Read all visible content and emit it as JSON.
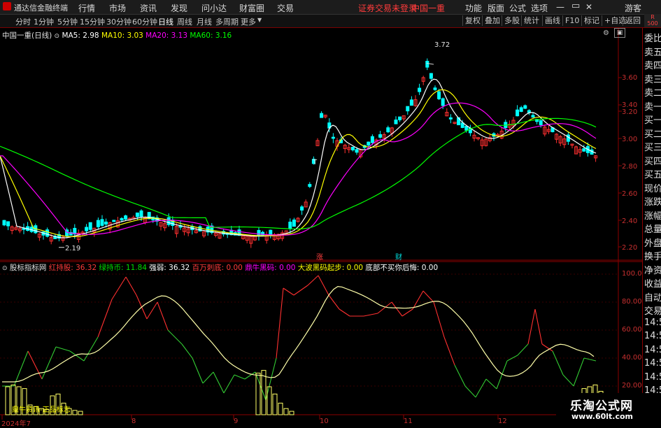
{
  "titlebar": {
    "app_name": "通达信金融终端",
    "menu": [
      "行情",
      "市场",
      "资讯",
      "发现",
      "问小达",
      "财富圈",
      "交易"
    ],
    "status": "证券交易未登录",
    "stock": "中国一重",
    "right_menu": [
      "功能",
      "版面",
      "公式",
      "选项"
    ],
    "guest": "游客"
  },
  "toolbar": {
    "periods": [
      "分时",
      "1分钟",
      "5分钟",
      "15分钟",
      "30分钟",
      "60分钟",
      "日线",
      "周线",
      "月线",
      "多周期",
      "更多"
    ],
    "active_period": "日线",
    "right_buttons": [
      "复权",
      "叠加",
      "多股",
      "统计",
      "画线",
      "F10",
      "标记",
      "+自选",
      "返回"
    ],
    "corner_badge_top": "R",
    "corner_badge_bottom": "500"
  },
  "main_chart": {
    "title": "中国一重(日线)",
    "ma": [
      {
        "label": "MA5: 2.98",
        "color": "#ffffff"
      },
      {
        "label": "MA10: 3.03",
        "color": "#ffff00"
      },
      {
        "label": "MA20: 3.13",
        "color": "#ff00ff"
      },
      {
        "label": "MA60: 3.16",
        "color": "#00ff00"
      }
    ],
    "y_ticks": [
      "3.60",
      "3.40",
      "3.20",
      "3.00",
      "2.80",
      "2.60",
      "2.40",
      "2.20"
    ],
    "high_label": "3.72",
    "low_label": "2.19",
    "marker_zhang": "涨",
    "marker_cai": "财",
    "marker_t": "T"
  },
  "indicator": {
    "name": "股标指标网",
    "items": [
      {
        "label": "红持股: 36.32",
        "color": "#ff3b3b"
      },
      {
        "label": "绿持币: 11.84",
        "color": "#00dd00"
      },
      {
        "label": "强弱: 36.32",
        "color": "#ffffff"
      },
      {
        "label": "百万刺底: 0.00",
        "color": "#ff3b3b"
      },
      {
        "label": "鼎牛黑码: 0.00",
        "color": "#ff00ff"
      },
      {
        "label": "大波黑码起步: 0.00",
        "color": "#ffff00"
      },
      {
        "label": "底部不买你后悔: 0.00",
        "color": "#ffffff"
      }
    ],
    "y_ticks": [
      "100.0",
      "80.00",
      "60.00",
      "40.00",
      "20.00"
    ],
    "bottom_text": "鼎牛资讯-正品标志"
  },
  "x_axis": {
    "labels": [
      "2024年7",
      "8",
      "9",
      "10",
      "11",
      "12"
    ]
  },
  "right_panel": {
    "items": [
      "委比",
      "卖五",
      "卖四",
      "卖三",
      "卖二",
      "卖一",
      "买一",
      "买二",
      "买三",
      "买四",
      "买五",
      "现价",
      "涨跌",
      "涨幅",
      "总量",
      "外盘",
      "换手",
      "净资",
      "收益",
      "自动",
      "交易",
      "14:56",
      "14:56",
      "14:56",
      "14:56",
      "14:56",
      "14:56",
      "14:56",
      "14:56"
    ]
  },
  "watermark": {
    "line1": "乐淘公式网",
    "line2": "www.60lt.com"
  },
  "colors": {
    "up": "#ff3030",
    "down": "#00ffff",
    "ma5": "#ffffff",
    "ma10": "#ffff00",
    "ma20": "#ff00ff",
    "ma60": "#00ff00",
    "grid": "#8b0000"
  }
}
